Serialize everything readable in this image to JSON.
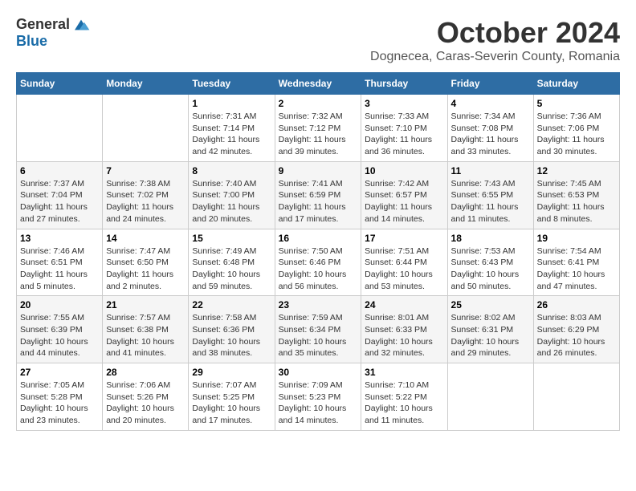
{
  "logo": {
    "general": "General",
    "blue": "Blue"
  },
  "title": {
    "month": "October 2024",
    "location": "Dognecea, Caras-Severin County, Romania"
  },
  "headers": [
    "Sunday",
    "Monday",
    "Tuesday",
    "Wednesday",
    "Thursday",
    "Friday",
    "Saturday"
  ],
  "weeks": [
    [
      {
        "day": "",
        "sunrise": "",
        "sunset": "",
        "daylight": ""
      },
      {
        "day": "",
        "sunrise": "",
        "sunset": "",
        "daylight": ""
      },
      {
        "day": "1",
        "sunrise": "Sunrise: 7:31 AM",
        "sunset": "Sunset: 7:14 PM",
        "daylight": "Daylight: 11 hours and 42 minutes."
      },
      {
        "day": "2",
        "sunrise": "Sunrise: 7:32 AM",
        "sunset": "Sunset: 7:12 PM",
        "daylight": "Daylight: 11 hours and 39 minutes."
      },
      {
        "day": "3",
        "sunrise": "Sunrise: 7:33 AM",
        "sunset": "Sunset: 7:10 PM",
        "daylight": "Daylight: 11 hours and 36 minutes."
      },
      {
        "day": "4",
        "sunrise": "Sunrise: 7:34 AM",
        "sunset": "Sunset: 7:08 PM",
        "daylight": "Daylight: 11 hours and 33 minutes."
      },
      {
        "day": "5",
        "sunrise": "Sunrise: 7:36 AM",
        "sunset": "Sunset: 7:06 PM",
        "daylight": "Daylight: 11 hours and 30 minutes."
      }
    ],
    [
      {
        "day": "6",
        "sunrise": "Sunrise: 7:37 AM",
        "sunset": "Sunset: 7:04 PM",
        "daylight": "Daylight: 11 hours and 27 minutes."
      },
      {
        "day": "7",
        "sunrise": "Sunrise: 7:38 AM",
        "sunset": "Sunset: 7:02 PM",
        "daylight": "Daylight: 11 hours and 24 minutes."
      },
      {
        "day": "8",
        "sunrise": "Sunrise: 7:40 AM",
        "sunset": "Sunset: 7:00 PM",
        "daylight": "Daylight: 11 hours and 20 minutes."
      },
      {
        "day": "9",
        "sunrise": "Sunrise: 7:41 AM",
        "sunset": "Sunset: 6:59 PM",
        "daylight": "Daylight: 11 hours and 17 minutes."
      },
      {
        "day": "10",
        "sunrise": "Sunrise: 7:42 AM",
        "sunset": "Sunset: 6:57 PM",
        "daylight": "Daylight: 11 hours and 14 minutes."
      },
      {
        "day": "11",
        "sunrise": "Sunrise: 7:43 AM",
        "sunset": "Sunset: 6:55 PM",
        "daylight": "Daylight: 11 hours and 11 minutes."
      },
      {
        "day": "12",
        "sunrise": "Sunrise: 7:45 AM",
        "sunset": "Sunset: 6:53 PM",
        "daylight": "Daylight: 11 hours and 8 minutes."
      }
    ],
    [
      {
        "day": "13",
        "sunrise": "Sunrise: 7:46 AM",
        "sunset": "Sunset: 6:51 PM",
        "daylight": "Daylight: 11 hours and 5 minutes."
      },
      {
        "day": "14",
        "sunrise": "Sunrise: 7:47 AM",
        "sunset": "Sunset: 6:50 PM",
        "daylight": "Daylight: 11 hours and 2 minutes."
      },
      {
        "day": "15",
        "sunrise": "Sunrise: 7:49 AM",
        "sunset": "Sunset: 6:48 PM",
        "daylight": "Daylight: 10 hours and 59 minutes."
      },
      {
        "day": "16",
        "sunrise": "Sunrise: 7:50 AM",
        "sunset": "Sunset: 6:46 PM",
        "daylight": "Daylight: 10 hours and 56 minutes."
      },
      {
        "day": "17",
        "sunrise": "Sunrise: 7:51 AM",
        "sunset": "Sunset: 6:44 PM",
        "daylight": "Daylight: 10 hours and 53 minutes."
      },
      {
        "day": "18",
        "sunrise": "Sunrise: 7:53 AM",
        "sunset": "Sunset: 6:43 PM",
        "daylight": "Daylight: 10 hours and 50 minutes."
      },
      {
        "day": "19",
        "sunrise": "Sunrise: 7:54 AM",
        "sunset": "Sunset: 6:41 PM",
        "daylight": "Daylight: 10 hours and 47 minutes."
      }
    ],
    [
      {
        "day": "20",
        "sunrise": "Sunrise: 7:55 AM",
        "sunset": "Sunset: 6:39 PM",
        "daylight": "Daylight: 10 hours and 44 minutes."
      },
      {
        "day": "21",
        "sunrise": "Sunrise: 7:57 AM",
        "sunset": "Sunset: 6:38 PM",
        "daylight": "Daylight: 10 hours and 41 minutes."
      },
      {
        "day": "22",
        "sunrise": "Sunrise: 7:58 AM",
        "sunset": "Sunset: 6:36 PM",
        "daylight": "Daylight: 10 hours and 38 minutes."
      },
      {
        "day": "23",
        "sunrise": "Sunrise: 7:59 AM",
        "sunset": "Sunset: 6:34 PM",
        "daylight": "Daylight: 10 hours and 35 minutes."
      },
      {
        "day": "24",
        "sunrise": "Sunrise: 8:01 AM",
        "sunset": "Sunset: 6:33 PM",
        "daylight": "Daylight: 10 hours and 32 minutes."
      },
      {
        "day": "25",
        "sunrise": "Sunrise: 8:02 AM",
        "sunset": "Sunset: 6:31 PM",
        "daylight": "Daylight: 10 hours and 29 minutes."
      },
      {
        "day": "26",
        "sunrise": "Sunrise: 8:03 AM",
        "sunset": "Sunset: 6:29 PM",
        "daylight": "Daylight: 10 hours and 26 minutes."
      }
    ],
    [
      {
        "day": "27",
        "sunrise": "Sunrise: 7:05 AM",
        "sunset": "Sunset: 5:28 PM",
        "daylight": "Daylight: 10 hours and 23 minutes."
      },
      {
        "day": "28",
        "sunrise": "Sunrise: 7:06 AM",
        "sunset": "Sunset: 5:26 PM",
        "daylight": "Daylight: 10 hours and 20 minutes."
      },
      {
        "day": "29",
        "sunrise": "Sunrise: 7:07 AM",
        "sunset": "Sunset: 5:25 PM",
        "daylight": "Daylight: 10 hours and 17 minutes."
      },
      {
        "day": "30",
        "sunrise": "Sunrise: 7:09 AM",
        "sunset": "Sunset: 5:23 PM",
        "daylight": "Daylight: 10 hours and 14 minutes."
      },
      {
        "day": "31",
        "sunrise": "Sunrise: 7:10 AM",
        "sunset": "Sunset: 5:22 PM",
        "daylight": "Daylight: 10 hours and 11 minutes."
      },
      {
        "day": "",
        "sunrise": "",
        "sunset": "",
        "daylight": ""
      },
      {
        "day": "",
        "sunrise": "",
        "sunset": "",
        "daylight": ""
      }
    ]
  ]
}
